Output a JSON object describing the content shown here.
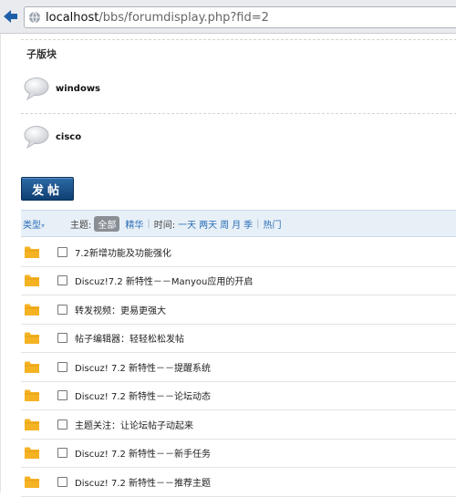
{
  "browser": {
    "url_host": "localhost",
    "url_path": "/bbs/forumdisplay.php?fid=2"
  },
  "subforums": {
    "title": "子版块",
    "items": [
      {
        "name": "windows"
      },
      {
        "name": "cisco"
      }
    ]
  },
  "post_button": {
    "label": "发帖"
  },
  "filter": {
    "type_label": "类型",
    "type_caret": "▾",
    "topic_label": "主题:",
    "all_label": "全部",
    "digest_label": "精华",
    "sep1": "|",
    "time_label": "时间:",
    "time_options": [
      "一天",
      "两天",
      "周",
      "月",
      "季"
    ],
    "sep2": "|",
    "hot_label": "热门"
  },
  "threads": [
    {
      "title": "7.2新增功能及功能强化"
    },
    {
      "title": "Discuz!7.2 新特性－－Manyou应用的开启"
    },
    {
      "title": "转发视频：更易更强大"
    },
    {
      "title": "帖子编辑器：轻轻松松发帖"
    },
    {
      "title": "Discuz! 7.2 新特性－－提醒系统"
    },
    {
      "title": "Discuz! 7.2 新特性－－论坛动态"
    },
    {
      "title": "主题关注：让论坛帖子动起来"
    },
    {
      "title": "Discuz! 7.2 新特性－－新手任务"
    },
    {
      "title": "Discuz! 7.2 新特性－－推荐主题"
    }
  ],
  "colors": {
    "link": "#2a6db8",
    "folder": "#f5b324",
    "button": "#164b82",
    "filter_bg": "#e8f0f7"
  }
}
